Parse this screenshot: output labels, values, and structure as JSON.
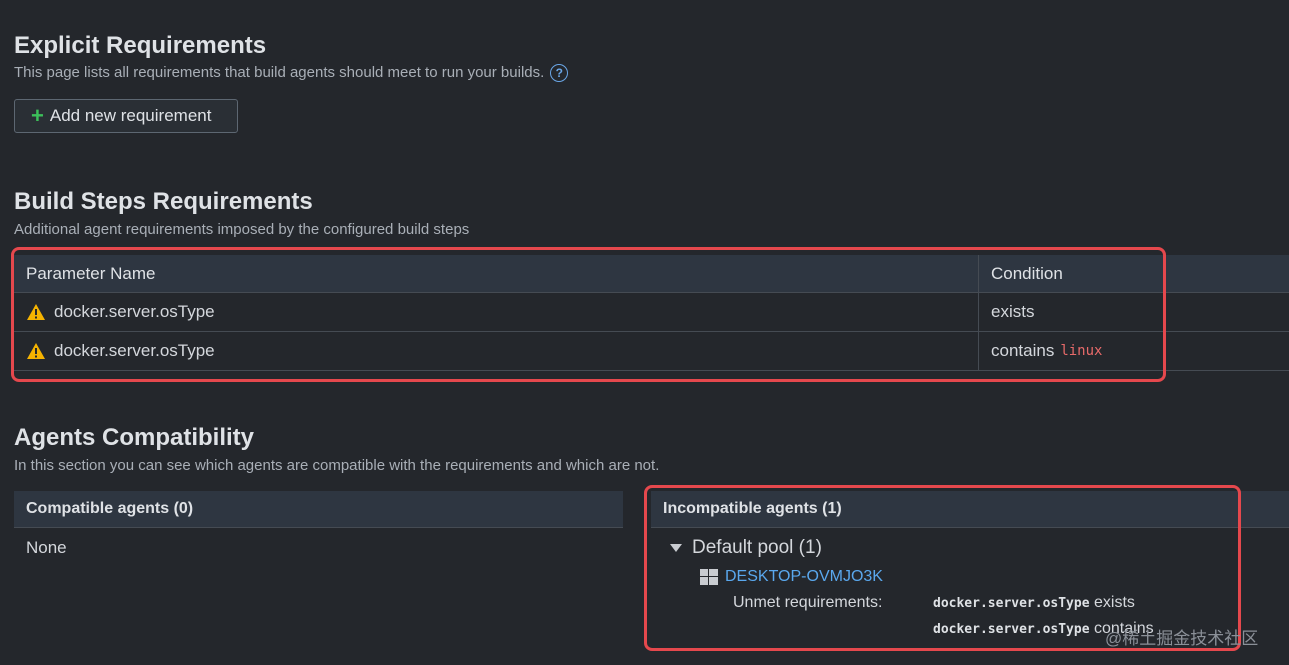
{
  "explicit": {
    "title": "Explicit Requirements",
    "description": "This page lists all requirements that build agents should meet to run your builds.",
    "help_glyph": "?",
    "add_button": "Add new requirement",
    "add_glyph": "+"
  },
  "build_steps": {
    "title": "Build Steps Requirements",
    "description": "Additional agent requirements imposed by the configured build steps",
    "columns": [
      "Parameter Name",
      "Condition"
    ],
    "rows": [
      {
        "param": "docker.server.osType",
        "condition": "exists",
        "value": ""
      },
      {
        "param": "docker.server.osType",
        "condition": "contains",
        "value": "linux"
      }
    ]
  },
  "agents": {
    "title": "Agents Compatibility",
    "description": "In this section you can see which agents are compatible with the requirements and which are not.",
    "compatible_header": "Compatible agents (0)",
    "compatible_empty": "None",
    "incompatible_header": "Incompatible agents (1)",
    "pool_name": "Default pool (1)",
    "agent_name": "DESKTOP-OVMJO3K",
    "unmet_label": "Unmet requirements:",
    "unmet": [
      {
        "param": "docker.server.osType",
        "text": "exists"
      },
      {
        "param": "docker.server.osType",
        "text": "contains"
      }
    ]
  },
  "watermark": "@稀土掘金技术社区",
  "colors": {
    "highlight": "#e5484d",
    "link": "#5aa8ee",
    "warning": "#f5b301",
    "plus": "#3cc05a",
    "code_value": "#e86a6a"
  },
  "icons": [
    "help-icon",
    "plus-icon",
    "warning-icon",
    "collapse-triangle-icon",
    "windows-icon"
  ]
}
